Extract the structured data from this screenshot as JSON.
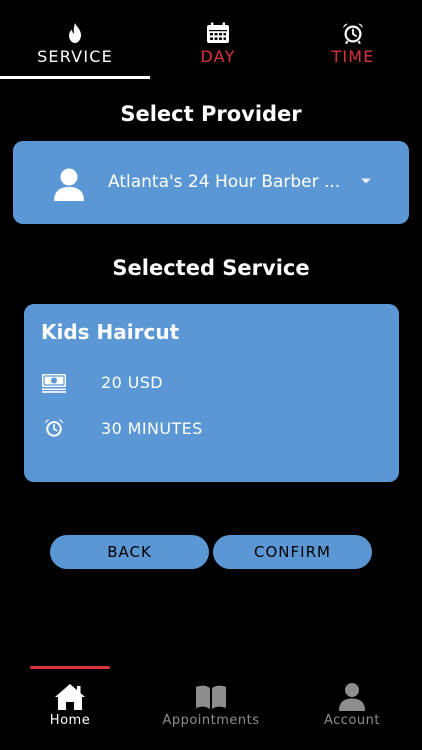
{
  "tabs": {
    "service": {
      "label": "SERVICE",
      "icon": "flame-icon"
    },
    "day": {
      "label": "DAY",
      "icon": "calendar-icon"
    },
    "time": {
      "label": "TIME",
      "icon": "alarm-clock-icon"
    }
  },
  "provider_section": {
    "heading": "Select Provider",
    "selected_provider": "Atlanta's 24 Hour Barber ...",
    "icon": "person-icon"
  },
  "service_section": {
    "heading": "Selected Service",
    "service_name": "Kids Haircut",
    "price": "20 USD",
    "duration": "30 MINUTES",
    "price_icon": "money-icon",
    "duration_icon": "alarm-clock-icon"
  },
  "actions": {
    "back_label": "BACK",
    "confirm_label": "CONFIRM"
  },
  "bottom_nav": {
    "items": [
      {
        "label": "Home",
        "icon": "home-icon",
        "active": true
      },
      {
        "label": "Appointments",
        "icon": "book-icon",
        "active": false
      },
      {
        "label": "Account",
        "icon": "account-icon",
        "active": false
      }
    ]
  },
  "colors": {
    "background": "#000000",
    "accent_blue": "#5b97d4",
    "accent_red": "#d8323c",
    "inactive_gray": "#8d8d8d"
  }
}
